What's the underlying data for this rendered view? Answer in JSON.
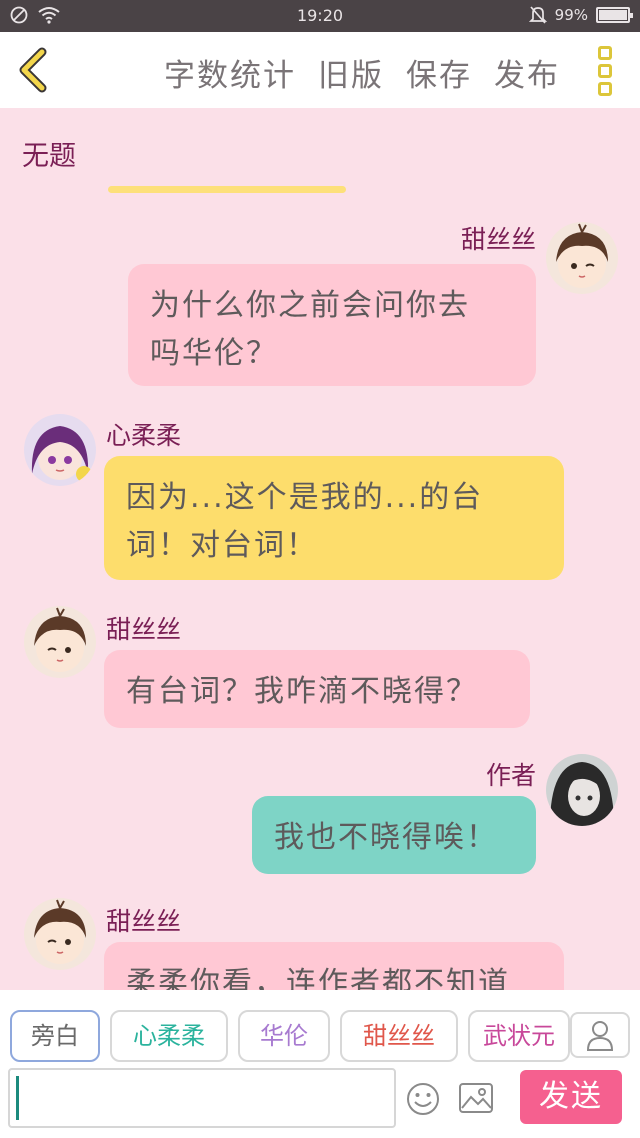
{
  "status_bar": {
    "time": "19:20",
    "battery": "99%",
    "battery_level": 0.99
  },
  "header": {
    "back_icon": "chevron-left-icon",
    "actions": [
      "字数统计",
      "旧版",
      "保存",
      "发布"
    ],
    "more_icon": "more-vertical-icon"
  },
  "document": {
    "title": "无题"
  },
  "messages": [
    {
      "speaker": "甜丝丝",
      "side": "right",
      "color": "pink",
      "text": "为什么你之前会问你去吗华伦？",
      "lines": [
        "为什么你之前会问你去",
        "吗华伦？"
      ]
    },
    {
      "speaker": "心柔柔",
      "side": "left",
      "color": "yellow",
      "text": "因为...这个是我的...的台词！对台词！",
      "lines": [
        "因为...这个是我的...的台",
        "词！对台词！"
      ]
    },
    {
      "speaker": "甜丝丝",
      "side": "left",
      "color": "pink",
      "text": "有台词？我咋滴不晓得？",
      "lines": [
        "有台词？我咋滴不晓得？"
      ]
    },
    {
      "speaker": "作者",
      "side": "right",
      "color": "teal",
      "text": "我也不晓得唉！",
      "lines": [
        "我也不晓得唉！"
      ]
    },
    {
      "speaker": "甜丝丝",
      "side": "left",
      "color": "pink",
      "text": "柔柔你看，连作者都不知道",
      "lines": [
        "柔柔你看，连作者都不知道"
      ]
    }
  ],
  "roles": [
    {
      "label": "旁白",
      "color": "#6a6a6a",
      "selected": true
    },
    {
      "label": "心柔柔",
      "color": "#2bb39d",
      "selected": false
    },
    {
      "label": "华伦",
      "color": "#a77ad0",
      "selected": false
    },
    {
      "label": "甜丝丝",
      "color": "#e0574b",
      "selected": false
    },
    {
      "label": "武状元",
      "color": "#c8489a",
      "selected": false
    }
  ],
  "composer": {
    "input_value": "",
    "emoji_icon": "smiley-icon",
    "image_icon": "image-icon",
    "send_label": "发送",
    "user_icon": "user-icon"
  },
  "colors": {
    "background": "#fbe0e8",
    "bubble_pink": "#ffc8d4",
    "bubble_yellow": "#fddd6c",
    "bubble_teal": "#7ed4c6",
    "name_color": "#7a1f55",
    "send_button": "#f5608f",
    "accent_yellow": "#dcc63a"
  }
}
